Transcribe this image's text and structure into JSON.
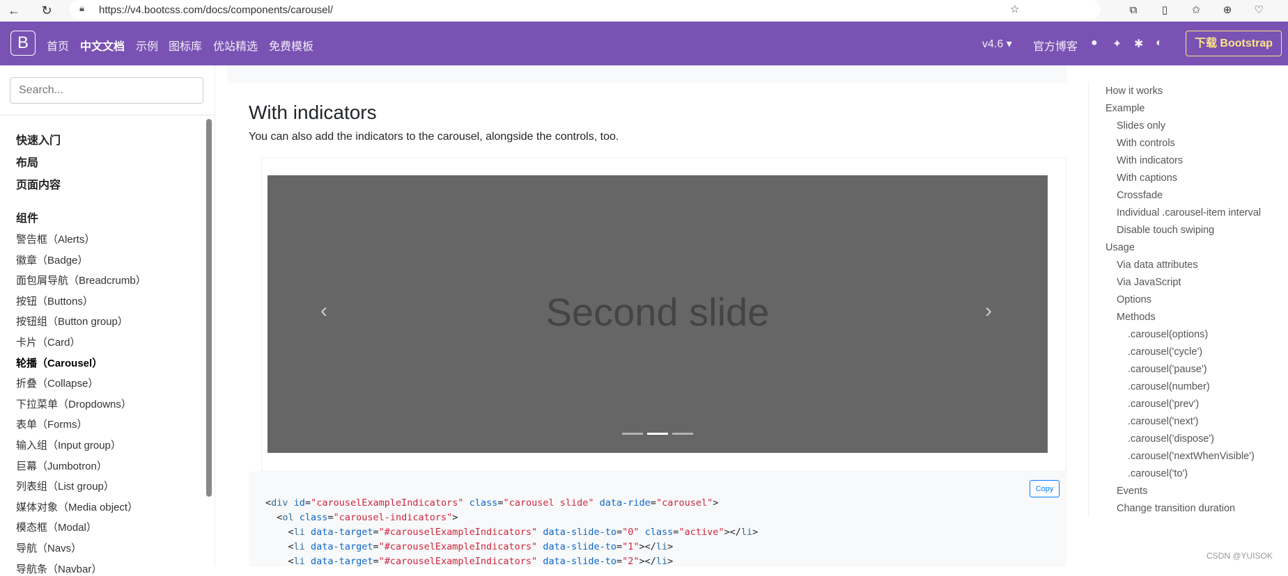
{
  "browser": {
    "url": "https://v4.bootcss.com/docs/components/carousel/"
  },
  "nav": {
    "logo": "B",
    "links": [
      "首页",
      "中文文档",
      "示例",
      "图标库",
      "优站精选",
      "免费模板"
    ],
    "version": "v4.6 ▾",
    "blog": "官方博客",
    "download": "下载 Bootstrap",
    "brand_color": "#7952b3"
  },
  "sidebar": {
    "search_placeholder": "Search...",
    "sections": [
      "快速入门",
      "布局",
      "页面内容",
      "组件"
    ],
    "items": [
      "警告框（Alerts）",
      "徽章（Badge）",
      "面包屑导航（Breadcrumb）",
      "按钮（Buttons）",
      "按钮组（Button group）",
      "卡片（Card）",
      "轮播（Carousel）",
      "折叠（Collapse）",
      "下拉菜单（Dropdowns）",
      "表单（Forms）",
      "输入组（Input group）",
      "巨幕（Jumbotron）",
      "列表组（List group）",
      "媒体对象（Media object）",
      "模态框（Modal）",
      "导航（Navs）",
      "导航条（Navbar）"
    ],
    "active": "轮播（Carousel）"
  },
  "main": {
    "heading": "With indicators",
    "paragraph": "You can also add the indicators to the carousel, alongside the controls, too.",
    "slide_text": "Second slide",
    "active_indicator": 1,
    "copy": "Copy"
  },
  "toc": [
    {
      "l": 0,
      "t": "How it works"
    },
    {
      "l": 0,
      "t": "Example"
    },
    {
      "l": 1,
      "t": "Slides only"
    },
    {
      "l": 1,
      "t": "With controls"
    },
    {
      "l": 1,
      "t": "With indicators"
    },
    {
      "l": 1,
      "t": "With captions"
    },
    {
      "l": 1,
      "t": "Crossfade"
    },
    {
      "l": 1,
      "t": "Individual .carousel-item interval"
    },
    {
      "l": 1,
      "t": "Disable touch swiping"
    },
    {
      "l": 0,
      "t": "Usage"
    },
    {
      "l": 1,
      "t": "Via data attributes"
    },
    {
      "l": 1,
      "t": "Via JavaScript"
    },
    {
      "l": 1,
      "t": "Options"
    },
    {
      "l": 1,
      "t": "Methods"
    },
    {
      "l": 2,
      "t": ".carousel(options)"
    },
    {
      "l": 2,
      "t": ".carousel('cycle')"
    },
    {
      "l": 2,
      "t": ".carousel('pause')"
    },
    {
      "l": 2,
      "t": ".carousel(number)"
    },
    {
      "l": 2,
      "t": ".carousel('prev')"
    },
    {
      "l": 2,
      "t": ".carousel('next')"
    },
    {
      "l": 2,
      "t": ".carousel('dispose')"
    },
    {
      "l": 2,
      "t": ".carousel('nextWhenVisible')"
    },
    {
      "l": 2,
      "t": ".carousel('to')"
    },
    {
      "l": 1,
      "t": "Events"
    },
    {
      "l": 1,
      "t": "Change transition duration"
    }
  ],
  "watermark": "CSDN @YUISOK"
}
